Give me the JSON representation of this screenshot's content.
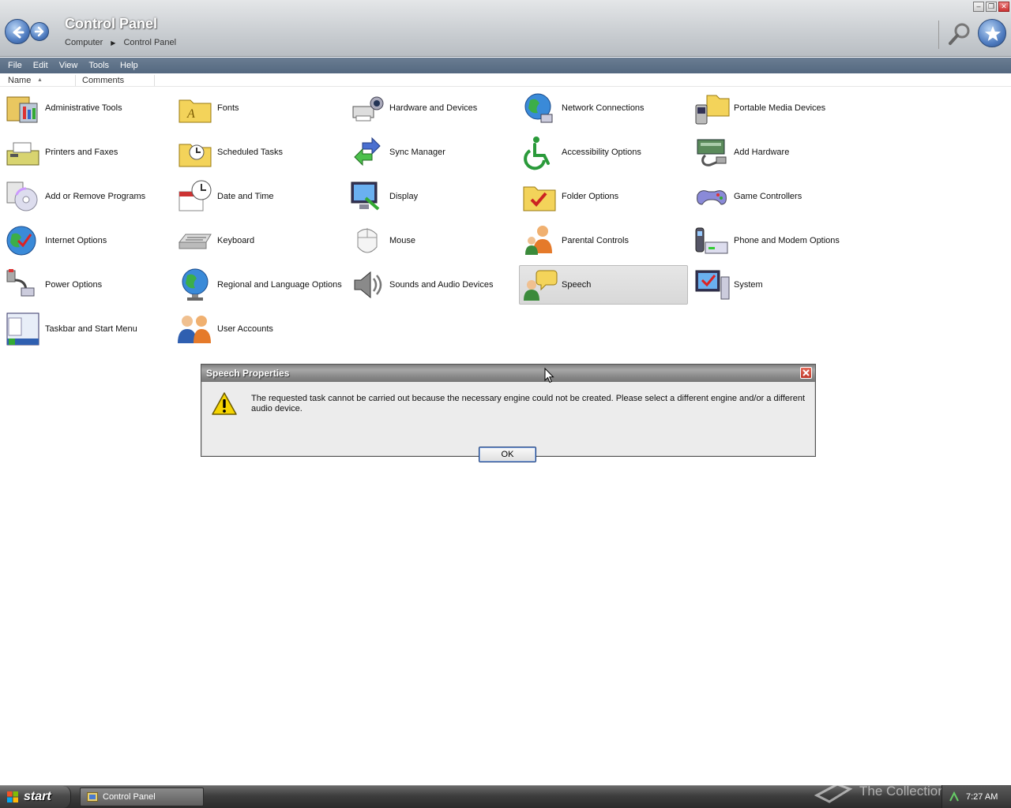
{
  "window": {
    "title": "Control Panel",
    "breadcrumb": [
      "Computer",
      "Control Panel"
    ]
  },
  "menu": [
    "File",
    "Edit",
    "View",
    "Tools",
    "Help"
  ],
  "columns": {
    "name": "Name",
    "comments": "Comments"
  },
  "items": [
    {
      "label": "Administrative Tools",
      "icon": "administrative-tools-icon"
    },
    {
      "label": "Fonts",
      "icon": "fonts-folder-icon"
    },
    {
      "label": "Hardware and Devices",
      "icon": "hardware-devices-icon"
    },
    {
      "label": "Network Connections",
      "icon": "network-globe-icon"
    },
    {
      "label": "Portable Media Devices",
      "icon": "portable-media-icon"
    },
    {
      "label": "Printers and Faxes",
      "icon": "printer-fax-icon"
    },
    {
      "label": "Scheduled Tasks",
      "icon": "scheduled-tasks-folder-icon"
    },
    {
      "label": "Sync Manager",
      "icon": "sync-arrows-icon"
    },
    {
      "label": "Accessibility Options",
      "icon": "accessibility-wheelchair-icon"
    },
    {
      "label": "Add Hardware",
      "icon": "add-hardware-icon"
    },
    {
      "label": "Add or Remove Programs",
      "icon": "add-remove-programs-icon"
    },
    {
      "label": "Date and Time",
      "icon": "date-time-clock-icon"
    },
    {
      "label": "Display",
      "icon": "display-monitor-icon"
    },
    {
      "label": "Folder Options",
      "icon": "folder-options-icon"
    },
    {
      "label": "Game Controllers",
      "icon": "gamepad-icon"
    },
    {
      "label": "Internet Options",
      "icon": "internet-globe-icon"
    },
    {
      "label": "Keyboard",
      "icon": "keyboard-icon"
    },
    {
      "label": "Mouse",
      "icon": "mouse-icon"
    },
    {
      "label": "Parental Controls",
      "icon": "parental-controls-icon"
    },
    {
      "label": "Phone and Modem Options",
      "icon": "phone-modem-icon"
    },
    {
      "label": "Power Options",
      "icon": "power-plug-icon"
    },
    {
      "label": "Regional and Language Options",
      "icon": "regional-globe-icon"
    },
    {
      "label": "Sounds and Audio Devices",
      "icon": "speaker-icon"
    },
    {
      "label": "Speech",
      "icon": "speech-bubble-icon",
      "selected": true
    },
    {
      "label": "System",
      "icon": "system-monitor-icon"
    },
    {
      "label": "Taskbar and Start Menu",
      "icon": "taskbar-start-icon"
    },
    {
      "label": "User Accounts",
      "icon": "user-accounts-icon"
    }
  ],
  "dialog": {
    "title": "Speech Properties",
    "message": "The requested task cannot be carried out because the necessary engine could not be created.  Please select a different engine and/or a different audio device.",
    "ok_label": "OK"
  },
  "taskbar": {
    "start_label": "start",
    "task_label": "Control Panel",
    "watermark": "The Collection Book",
    "clock": "7:27 AM"
  }
}
